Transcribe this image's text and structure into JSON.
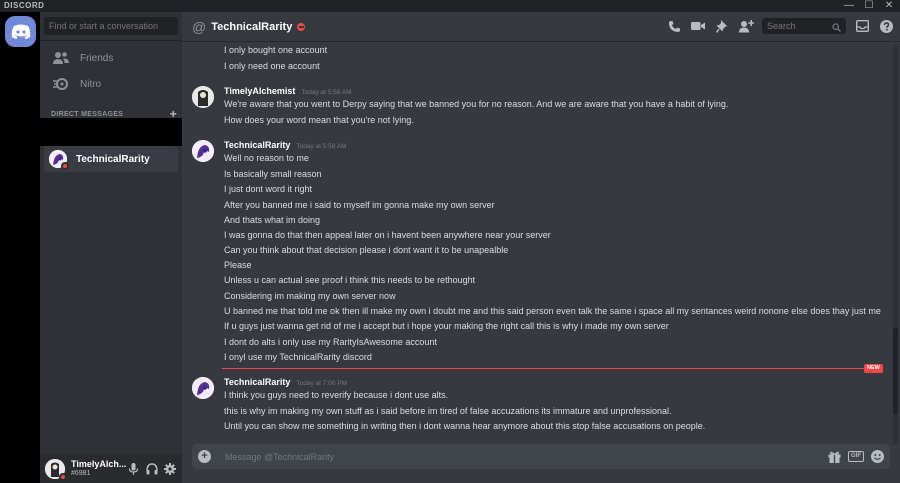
{
  "app": {
    "brand": "DISCORD"
  },
  "window_buttons": [
    "—",
    "☐",
    "✕"
  ],
  "sidebar": {
    "search_placeholder": "Find or start a conversation",
    "nav": [
      {
        "label": "Friends",
        "icon": "friends-icon"
      },
      {
        "label": "Nitro",
        "icon": "nitro-icon"
      }
    ],
    "dm_header": "DIRECT MESSAGES",
    "dm_add": "+",
    "dms": [
      {
        "name": "TechnicalRarity",
        "status": "dnd"
      }
    ]
  },
  "user_panel": {
    "username": "TimelyAlch...",
    "tag": "#6981"
  },
  "chat": {
    "at_symbol": "@",
    "title": "TechnicalRarity",
    "search_placeholder": "Search",
    "composer_placeholder": "Message @TechnicalRarity",
    "new_badge": "NEW",
    "gif_label": "GIF"
  },
  "messages": {
    "orphan": [
      "I only bought one account",
      "I only need one account"
    ],
    "groups": [
      {
        "author": "TimelyAlchemist",
        "timestamp": "Today at 5:58 AM",
        "lines": [
          "We're aware that you went to Derpy saying that we banned you for no reason. And we are aware that you have a habit of lying.",
          "How does your word mean that you're not lying."
        ]
      },
      {
        "author": "TechnicalRarity",
        "timestamp": "Today at 5:58 AM",
        "lines": [
          "Well no reason to me",
          "Is basically small reason",
          "I just dont word it right",
          "After you banned me i said to myself im gonna make my own server",
          "And thats what im doing",
          "I was gonna do that then appeal later on i havent been anywhere near your server",
          "Can you think about that decision please i dont want it to be unapealble",
          "Please",
          "Unless u can actual see proof i think this needs to be rethought",
          "Considering im making my own server now",
          "U banned me that told me ok then ill make my own i doubt me and this said person even talk the same i space all my sentances weird nonone else does thay just me",
          "If u guys just wanna get rid of me i accept but i hope your making the right call this is why i made my own server",
          "I dont do alts i only use my RarityIsAwesome account",
          "I onyl use my TechnicalRarity discord"
        ]
      },
      {
        "author": "TechnicalRarity",
        "timestamp": "Today at 7:00 PM",
        "lines": [
          "I think you guys need to reverify because i dont use alts.",
          "this is why im making my own stuff as i said before im tired of false accuzations its immature and unprofessional.",
          "Until you can show me something in writing then i dont wanna hear anymore about this stop false accusations on people."
        ]
      }
    ]
  },
  "colors": {
    "blurple": "#7289da",
    "dnd": "#f04747",
    "bg_chat": "#36393f",
    "bg_sidebar": "#2f3136"
  }
}
